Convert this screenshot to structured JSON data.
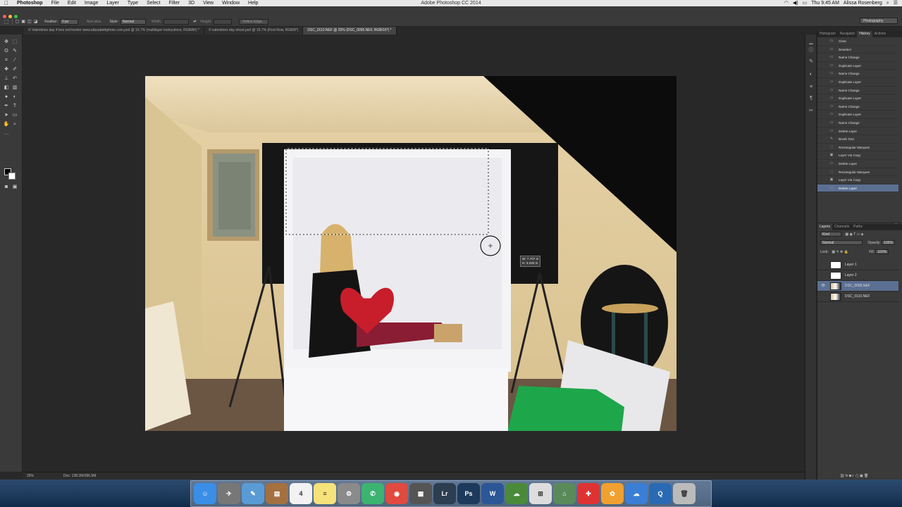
{
  "menubar": {
    "app_name": "Photoshop",
    "items": [
      "File",
      "Edit",
      "Image",
      "Layer",
      "Type",
      "Select",
      "Filter",
      "3D",
      "View",
      "Window",
      "Help"
    ],
    "window_title": "Adobe Photoshop CC 2014",
    "clock": "Thu 9:45 AM",
    "user": "Alissa Rosenberg"
  },
  "options": {
    "feather_label": "Feather:",
    "feather_value": "0 px",
    "antialias_label": "Anti-alias",
    "style_label": "Style:",
    "style_value": "Normal",
    "width_label": "Width:",
    "height_label": "Height:",
    "refine_label": "Refine Edge...",
    "workspace": "Photography"
  },
  "tabs": [
    {
      "label": "© Valentines day 4 box red border www.alissabethphoto.com.psd @ 16.7% (multilayer instructions, RGB/8#) *",
      "active": false
    },
    {
      "label": "© valentines day shoot.psd @ 16.7% (First Row, RGB/8*)",
      "active": false
    },
    {
      "label": "DSC_0110.NEF @ 25% (DSC_0095.NEF, RGB/16*) *",
      "active": true
    }
  ],
  "status": {
    "zoom": "25%",
    "doc": "Doc: 138.2M/396.5M"
  },
  "measure": {
    "w": "W: 7.707 in",
    "h": "H: 3.220 in"
  },
  "history_tabs": [
    "Histogram",
    "Navigator",
    "History",
    "Actions"
  ],
  "history": [
    "Clear",
    "Deselect",
    "Name Change",
    "Duplicate Layer",
    "Name Change",
    "Duplicate Layer",
    "Name Change",
    "Duplicate Layer",
    "Name Change",
    "Duplicate Layer",
    "Name Change",
    "Delete Layer",
    "Brush Tool",
    "Rectangular Marquee",
    "Layer Via Copy",
    "Delete Layer",
    "Rectangular Marquee",
    "Layer Via Copy",
    "Delete Layer"
  ],
  "layers_tabs": [
    "Layers",
    "Channels",
    "Paths"
  ],
  "layers": {
    "kind_label": "Kind",
    "blend_mode": "Normal",
    "opacity_label": "Opacity:",
    "opacity_value": "100%",
    "lock_label": "Lock:",
    "fill_label": "Fill:",
    "fill_value": "100%",
    "items": [
      {
        "name": "Layer 1",
        "visible": false,
        "active": false
      },
      {
        "name": "Layer 2",
        "visible": false,
        "active": false
      },
      {
        "name": "DSC_0095.NEF",
        "visible": true,
        "active": true
      },
      {
        "name": "DSC_0110.NEF",
        "visible": false,
        "active": false
      }
    ]
  },
  "dock": [
    {
      "name": "finder",
      "glyph": "☺",
      "color": "#3a8ee6"
    },
    {
      "name": "launchpad",
      "glyph": "✈",
      "color": "#777"
    },
    {
      "name": "preview",
      "glyph": "✎",
      "color": "#5a9bd5"
    },
    {
      "name": "notebook",
      "glyph": "▤",
      "color": "#a47040"
    },
    {
      "name": "calendar",
      "glyph": "4",
      "color": "#f2f2f2"
    },
    {
      "name": "notes",
      "glyph": "≡",
      "color": "#f6e27a"
    },
    {
      "name": "system-preferences",
      "glyph": "⚙",
      "color": "#8a8a8a"
    },
    {
      "name": "facetime",
      "glyph": "✆",
      "color": "#3cb371"
    },
    {
      "name": "chrome",
      "glyph": "◉",
      "color": "#e04a3f"
    },
    {
      "name": "calculator",
      "glyph": "▦",
      "color": "#555"
    },
    {
      "name": "lightroom",
      "glyph": "Lr",
      "color": "#2c3e50"
    },
    {
      "name": "photoshop",
      "glyph": "Ps",
      "color": "#1d3a5c"
    },
    {
      "name": "word",
      "glyph": "W",
      "color": "#2b5797"
    },
    {
      "name": "network",
      "glyph": "☁",
      "color": "#4a8a3a"
    },
    {
      "name": "grid-app",
      "glyph": "⊞",
      "color": "#ddd"
    },
    {
      "name": "home",
      "glyph": "⌂",
      "color": "#5a8a5a"
    },
    {
      "name": "first-aid",
      "glyph": "✚",
      "color": "#d33"
    },
    {
      "name": "photos",
      "glyph": "✿",
      "color": "#f0a030"
    },
    {
      "name": "icloud",
      "glyph": "☁",
      "color": "#3a7fd5"
    },
    {
      "name": "quicktime",
      "glyph": "Q",
      "color": "#2a6ab3"
    },
    {
      "name": "trash",
      "glyph": "🗑",
      "color": "#bbb"
    }
  ]
}
